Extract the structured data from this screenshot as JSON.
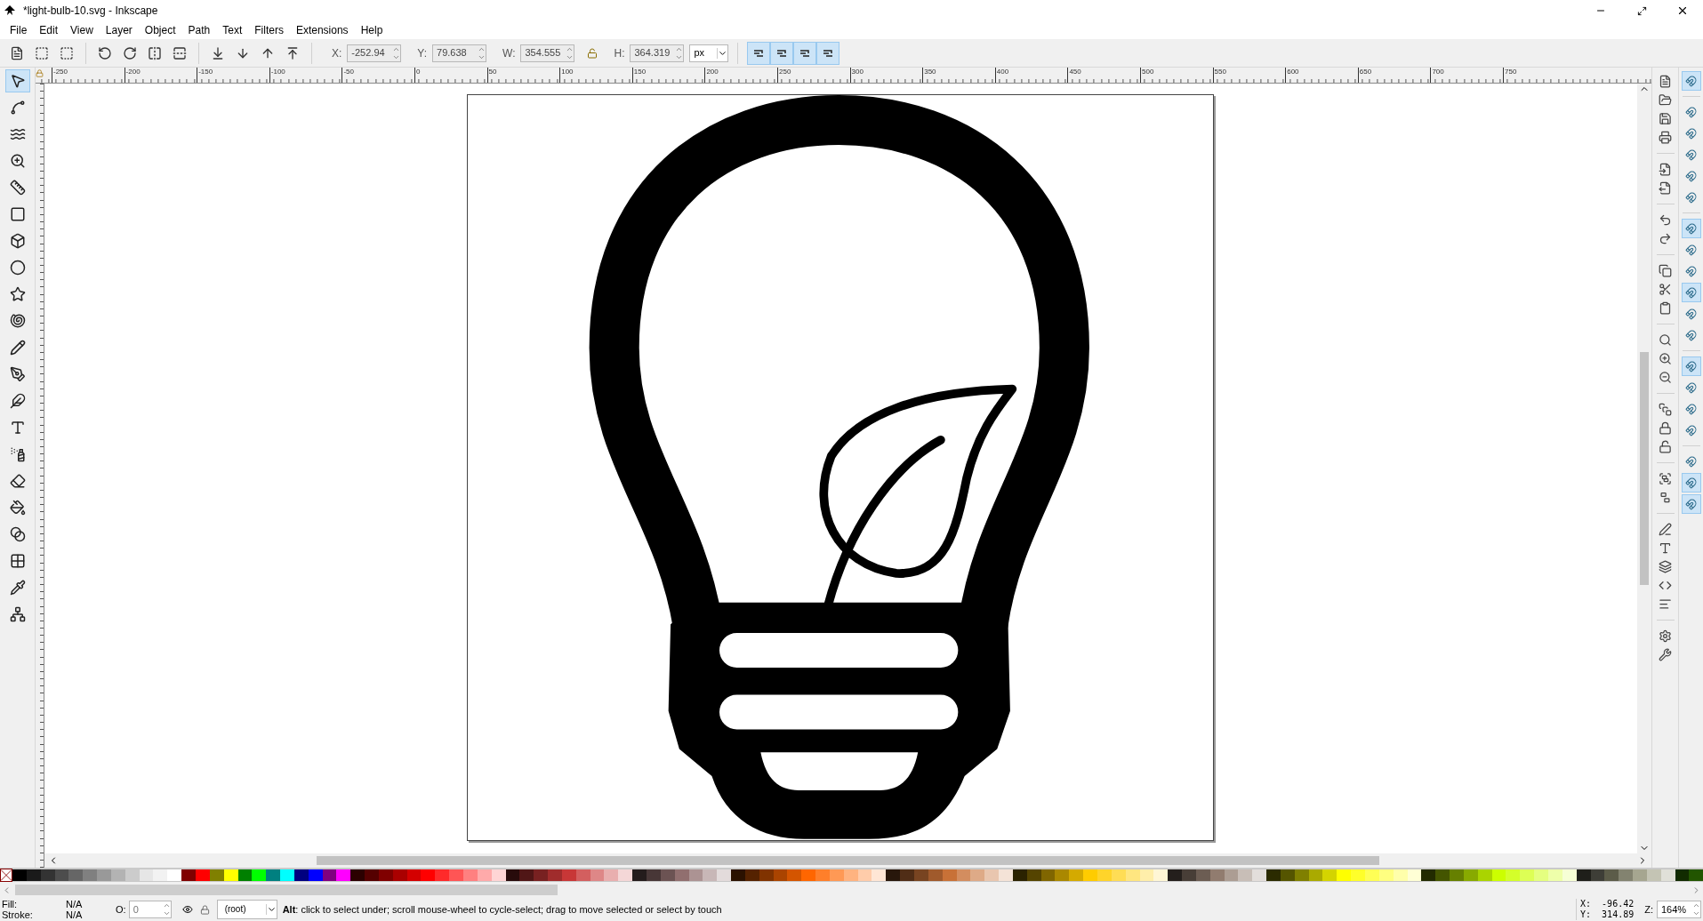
{
  "window": {
    "title": "*light-bulb-10.svg - Inkscape"
  },
  "menu": [
    "File",
    "Edit",
    "View",
    "Layer",
    "Object",
    "Path",
    "Text",
    "Filters",
    "Extensions",
    "Help"
  ],
  "toolbar": {
    "fields": [
      {
        "label": "X:",
        "value": "-252.94"
      },
      {
        "label": "Y:",
        "value": "79.638"
      },
      {
        "label": "W:",
        "value": "354.555"
      },
      {
        "label": "H:",
        "value": "364.319"
      }
    ],
    "unit": "px",
    "toggles": [
      {
        "on": true
      },
      {
        "on": true
      },
      {
        "on": true
      },
      {
        "on": true
      }
    ]
  },
  "ruler": {
    "horizontal": [
      "-250",
      "-200",
      "-150",
      "-100",
      "-50",
      "0",
      "50",
      "100",
      "150",
      "200",
      "250",
      "300",
      "350",
      "400",
      "450",
      "500",
      "550",
      "600",
      "650",
      "700",
      "750"
    ]
  },
  "tools": [
    {
      "kind": "selector",
      "selected": true
    },
    {
      "kind": "node",
      "selected": false
    },
    {
      "kind": "tweak",
      "selected": false
    },
    {
      "kind": "zoom",
      "selected": false
    },
    {
      "kind": "measure",
      "selected": false
    },
    {
      "kind": "rect",
      "selected": false
    },
    {
      "kind": "box3d",
      "selected": false
    },
    {
      "kind": "ellipse",
      "selected": false
    },
    {
      "kind": "star",
      "selected": false
    },
    {
      "kind": "spiral",
      "selected": false
    },
    {
      "kind": "pencil",
      "selected": false
    },
    {
      "kind": "pen",
      "selected": false
    },
    {
      "kind": "calligraphy",
      "selected": false
    },
    {
      "kind": "text",
      "selected": false
    },
    {
      "kind": "spray",
      "selected": false
    },
    {
      "kind": "eraser",
      "selected": false
    },
    {
      "kind": "bucket",
      "selected": false
    },
    {
      "kind": "gradient",
      "selected": false
    },
    {
      "kind": "mesh",
      "selected": false
    },
    {
      "kind": "dropper",
      "selected": false
    },
    {
      "kind": "connector",
      "selected": false
    }
  ],
  "snap": [
    {
      "on": true
    },
    {
      "on": false
    },
    {
      "on": false
    },
    {
      "on": false
    },
    {
      "on": false
    },
    {
      "on": false
    },
    {
      "on": true
    },
    {
      "on": false
    },
    {
      "on": false
    },
    {
      "on": true
    },
    {
      "on": false
    },
    {
      "on": false
    },
    {
      "on": true
    },
    {
      "on": false
    },
    {
      "on": false
    },
    {
      "on": false
    },
    {
      "on": false
    },
    {
      "on": true
    },
    {
      "on": true
    }
  ],
  "palette": [
    {
      "color": "#000000"
    },
    {
      "color": "#1a1a1a"
    },
    {
      "color": "#333333"
    },
    {
      "color": "#4d4d4d"
    },
    {
      "color": "#666666"
    },
    {
      "color": "#808080"
    },
    {
      "color": "#999999"
    },
    {
      "color": "#b3b3b3"
    },
    {
      "color": "#cccccc"
    },
    {
      "color": "#e6e6e6"
    },
    {
      "color": "#f2f2f2"
    },
    {
      "color": "#ffffff"
    },
    {
      "color": "#800000"
    },
    {
      "color": "#ff0000"
    },
    {
      "color": "#808000"
    },
    {
      "color": "#ffff00"
    },
    {
      "color": "#008000"
    },
    {
      "color": "#00ff00"
    },
    {
      "color": "#008080"
    },
    {
      "color": "#00ffff"
    },
    {
      "color": "#000080"
    },
    {
      "color": "#0000ff"
    },
    {
      "color": "#800080"
    },
    {
      "color": "#ff00ff"
    },
    {
      "color": "#2b0000"
    },
    {
      "color": "#550000"
    },
    {
      "color": "#800000"
    },
    {
      "color": "#aa0000"
    },
    {
      "color": "#d40000"
    },
    {
      "color": "#ff0000"
    },
    {
      "color": "#ff2a2a"
    },
    {
      "color": "#ff5555"
    },
    {
      "color": "#ff8080"
    },
    {
      "color": "#ffaaaa"
    },
    {
      "color": "#ffd5d5"
    },
    {
      "color": "#280b0b"
    },
    {
      "color": "#501616"
    },
    {
      "color": "#782121"
    },
    {
      "color": "#a02c2c"
    },
    {
      "color": "#c83737"
    },
    {
      "color": "#d35f5f"
    },
    {
      "color": "#de8787"
    },
    {
      "color": "#e9afaf"
    },
    {
      "color": "#f4d7d7"
    },
    {
      "color": "#241c1c"
    },
    {
      "color": "#483737"
    },
    {
      "color": "#6c5353"
    },
    {
      "color": "#916f6f"
    },
    {
      "color": "#ac9393"
    },
    {
      "color": "#c8b7b7"
    },
    {
      "color": "#e3dbdb"
    },
    {
      "color": "#2b1100"
    },
    {
      "color": "#552200"
    },
    {
      "color": "#803300"
    },
    {
      "color": "#aa4400"
    },
    {
      "color": "#d45500"
    },
    {
      "color": "#ff6600"
    },
    {
      "color": "#ff7f2a"
    },
    {
      "color": "#ff9955"
    },
    {
      "color": "#ffb380"
    },
    {
      "color": "#ffccaa"
    },
    {
      "color": "#ffe6d5"
    },
    {
      "color": "#28170b"
    },
    {
      "color": "#502d16"
    },
    {
      "color": "#784421"
    },
    {
      "color": "#a05a2c"
    },
    {
      "color": "#c87137"
    },
    {
      "color": "#d38d5f"
    },
    {
      "color": "#deaa87"
    },
    {
      "color": "#e9c6af"
    },
    {
      "color": "#f4e3d7"
    },
    {
      "color": "#2b2200"
    },
    {
      "color": "#554400"
    },
    {
      "color": "#806600"
    },
    {
      "color": "#aa8800"
    },
    {
      "color": "#d4aa00"
    },
    {
      "color": "#ffcc00"
    },
    {
      "color": "#ffd42a"
    },
    {
      "color": "#ffdd55"
    },
    {
      "color": "#ffe680"
    },
    {
      "color": "#ffeeaa"
    },
    {
      "color": "#fff6d5"
    },
    {
      "color": "#241f1c"
    },
    {
      "color": "#483e37"
    },
    {
      "color": "#6c5d53"
    },
    {
      "color": "#917c6f"
    },
    {
      "color": "#ac9d93"
    },
    {
      "color": "#c8beb7"
    },
    {
      "color": "#e3dedb"
    },
    {
      "color": "#2b2b00"
    },
    {
      "color": "#555500"
    },
    {
      "color": "#808000"
    },
    {
      "color": "#aaaa00"
    },
    {
      "color": "#d4d400"
    },
    {
      "color": "#ffff00"
    },
    {
      "color": "#ffff2a"
    },
    {
      "color": "#ffff55"
    },
    {
      "color": "#ffff80"
    },
    {
      "color": "#ffffaa"
    },
    {
      "color": "#ffffd5"
    },
    {
      "color": "#222b00"
    },
    {
      "color": "#445500"
    },
    {
      "color": "#668000"
    },
    {
      "color": "#88aa00"
    },
    {
      "color": "#aad400"
    },
    {
      "color": "#ccff00"
    },
    {
      "color": "#d4ff2a"
    },
    {
      "color": "#ddff55"
    },
    {
      "color": "#e5ff80"
    },
    {
      "color": "#eeffaa"
    },
    {
      "color": "#f6ffd5"
    },
    {
      "color": "#1f1f1a"
    },
    {
      "color": "#3e3e37"
    },
    {
      "color": "#5c5c49"
    },
    {
      "color": "#838370"
    },
    {
      "color": "#a6a690"
    },
    {
      "color": "#c4c4b4"
    },
    {
      "color": "#e0e0d8"
    },
    {
      "color": "#112b00"
    },
    {
      "color": "#225500"
    }
  ],
  "status": {
    "fill_label": "Fill:",
    "fill_value": "N/A",
    "stroke_label": "Stroke:",
    "stroke_value": "N/A",
    "opacity_label": "O:",
    "opacity_value": "0",
    "layer": "(root)",
    "message": "**Alt**: click to select under; scroll mouse-wheel to cycle-select; drag to move selected or select by touch",
    "x_label": "X:",
    "x_value": "-96.42",
    "y_label": "Y:",
    "y_value": "314.89",
    "zoom_label": "Z:",
    "zoom_value": "164%"
  }
}
